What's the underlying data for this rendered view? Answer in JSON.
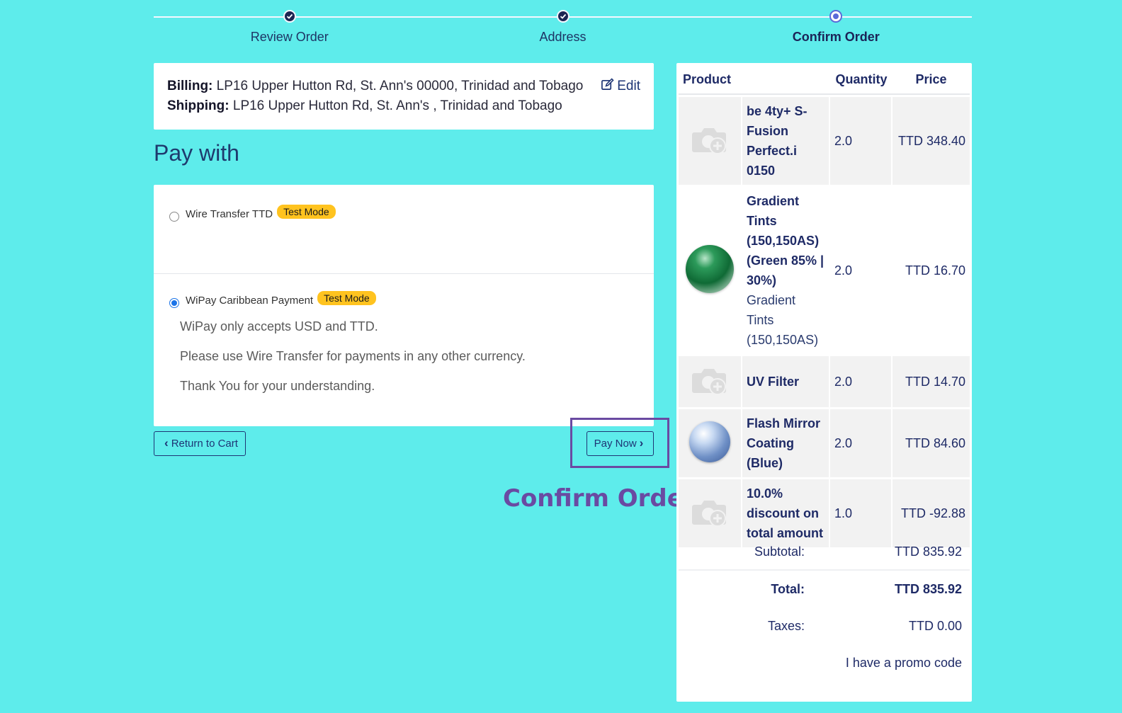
{
  "steps": [
    {
      "label": "Review Order",
      "state": "done"
    },
    {
      "label": "Address",
      "state": "done"
    },
    {
      "label": "Confirm Order",
      "state": "current"
    }
  ],
  "address": {
    "billing_label": "Billing:",
    "billing_value": "LP16 Upper Hutton Rd, St. Ann's 00000, Trinidad and Tobago",
    "shipping_label": "Shipping:",
    "shipping_value": "LP16 Upper Hutton Rd, St. Ann's , Trinidad and Tobago",
    "edit_label": "Edit"
  },
  "payment": {
    "title": "Pay with",
    "options": [
      {
        "label": "Wire Transfer TTD",
        "badge": "Test Mode",
        "selected": false
      },
      {
        "label": "WiPay Caribbean Payment",
        "badge": "Test Mode",
        "selected": true,
        "notes": [
          "WiPay only accepts USD and TTD.",
          "Please use Wire Transfer for payments in any other currency.",
          "Thank You for your understanding."
        ]
      }
    ]
  },
  "buttons": {
    "return_label": "Return to Cart",
    "pay_label": "Pay Now"
  },
  "annotation": {
    "label": "Confirm Order",
    "color": "#6a4aa2"
  },
  "summary": {
    "headers": {
      "product": "Product",
      "quantity": "Quantity",
      "price": "Price"
    },
    "items": [
      {
        "name": "be 4ty+ S-Fusion Perfect.i 0150",
        "sub": "",
        "quantity": "2.0",
        "price": "TTD 348.40",
        "image": "camera-placeholder-icon"
      },
      {
        "name": "Gradient Tints (150,150AS) (Green 85% | 30%)",
        "sub": "Gradient Tints (150,150AS)",
        "quantity": "2.0",
        "price": "TTD 16.70",
        "image": "green-lens-icon"
      },
      {
        "name": "UV Filter",
        "sub": "",
        "quantity": "2.0",
        "price": "TTD 14.70",
        "image": "camera-placeholder-icon"
      },
      {
        "name": "Flash Mirror Coating (Blue)",
        "sub": "",
        "quantity": "2.0",
        "price": "TTD 84.60",
        "image": "blue-lens-icon"
      },
      {
        "name": "10.0% discount on total amount",
        "sub": "",
        "quantity": "1.0",
        "price": "TTD -92.88",
        "image": "camera-placeholder-icon"
      }
    ],
    "subtotal_label": "Subtotal:",
    "subtotal_value": "TTD 835.92",
    "total_label": "Total:",
    "total_value": "TTD 835.92",
    "taxes_label": "Taxes:",
    "taxes_value": "TTD 0.00",
    "promo_label": "I have a promo code"
  },
  "colors": {
    "background": "#5eeceb",
    "primary": "#1e3575",
    "badge": "#ffc31f",
    "radio": "#1a73e8"
  }
}
